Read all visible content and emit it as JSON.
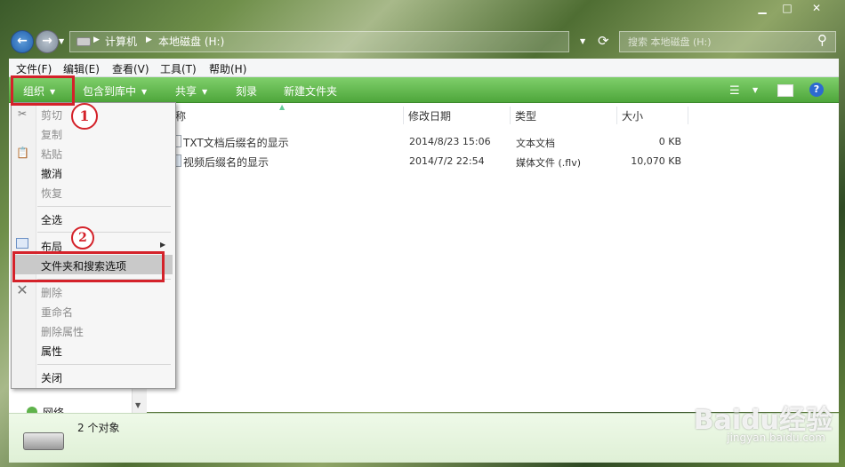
{
  "window": {
    "controls": {
      "minimize": "▁",
      "maximize": "□",
      "close": "✕"
    }
  },
  "address": {
    "path": [
      "计算机",
      "本地磁盘 (H:)"
    ],
    "search_placeholder": "搜索 本地磁盘 (H:)"
  },
  "menubar": {
    "items": [
      "文件(F)",
      "编辑(E)",
      "查看(V)",
      "工具(T)",
      "帮助(H)"
    ]
  },
  "toolbar": {
    "organize": "组织",
    "include_library": "包含到库中",
    "share": "共享",
    "burn": "刻录",
    "new_folder": "新建文件夹"
  },
  "columns": {
    "name": "名称",
    "date": "修改日期",
    "type": "类型",
    "size": "大小"
  },
  "files": [
    {
      "name": "TXT文档后缀名的显示",
      "date": "2014/8/23 15:06",
      "type": "文本文档",
      "size": "0 KB"
    },
    {
      "name": "视频后缀名的显示",
      "date": "2014/7/2 22:54",
      "type": "媒体文件 (.flv)",
      "size": "10,070 KB"
    }
  ],
  "organize_menu": {
    "cut": "剪切",
    "copy": "复制",
    "paste": "粘贴",
    "undo": "撤消",
    "redo": "恢复",
    "select_all": "全选",
    "layout": "布局",
    "folder_options": "文件夹和搜索选项",
    "delete": "删除",
    "rename": "重命名",
    "remove_properties": "删除属性",
    "properties": "属性",
    "close": "关闭"
  },
  "annotations": {
    "badge1": "1",
    "badge2": "2"
  },
  "nav": {
    "network": "网络"
  },
  "status": {
    "count": "2 个对象"
  },
  "watermark": {
    "brand": "Baidu经验",
    "url": "jingyan.baidu.com"
  },
  "colors": {
    "toolbar_green": "#4ea63b",
    "highlight_red": "#d4222a",
    "status_green": "#dff0d6"
  }
}
